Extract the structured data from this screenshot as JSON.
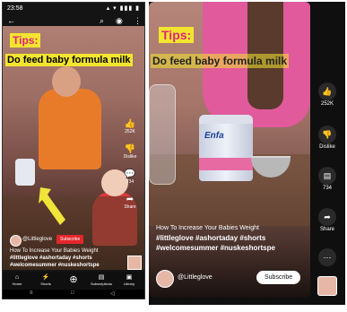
{
  "left": {
    "status": {
      "time": "23:58",
      "icons": "▴ ▾ ▮▮▮ ▮"
    },
    "top_icons": {
      "back": "←",
      "search": "⌕",
      "camera": "◉",
      "more": "⋮"
    },
    "overlay": {
      "tips": "Tips:",
      "headline": "Do feed baby formula milk"
    },
    "actions": [
      {
        "icon": "👍",
        "label": "252K"
      },
      {
        "icon": "👎",
        "label": "Dislike"
      },
      {
        "icon": "💬",
        "label": "734"
      },
      {
        "icon": "➦",
        "label": "Share"
      }
    ],
    "channel": {
      "name": "@Littleglove",
      "subscribe": "Subscribe"
    },
    "title": "How To Increase Your Babies Weight",
    "tags": "#littleglove #ashortaday #shorts #welcomesummer #nuskeshortspe",
    "nav": [
      {
        "icon": "⌂",
        "label": "Home"
      },
      {
        "icon": "⚡",
        "label": "Shorts"
      },
      {
        "icon": "⊕",
        "label": ""
      },
      {
        "icon": "▤",
        "label": "Subscriptions"
      },
      {
        "icon": "▣",
        "label": "Library"
      }
    ],
    "system_nav": {
      "menu": "≡",
      "home": "□",
      "back": "◁"
    }
  },
  "right": {
    "overlay": {
      "tips": "Tips:",
      "headline": "Do feed baby formula milk",
      "can_logo": "Enfa"
    },
    "title": "How To Increase Your Babies Weight",
    "tags": "#littleglove #ashortaday #shorts #welcomesummer #nuskeshortspe",
    "channel": {
      "name": "@Littleglove",
      "subscribe": "Subscribe"
    },
    "actions": [
      {
        "icon": "👍",
        "label": "252K"
      },
      {
        "icon": "👎",
        "label": "Dislike"
      },
      {
        "icon": "▤",
        "label": "734"
      },
      {
        "icon": "➦",
        "label": "Share"
      },
      {
        "icon": "⋯",
        "label": ""
      }
    ]
  },
  "colors": {
    "subscribe_red": "#e3262c",
    "tips_yellow": "#f3e52f",
    "tips_pink": "#e0247a",
    "arrow_yellow": "#f1e43a"
  }
}
